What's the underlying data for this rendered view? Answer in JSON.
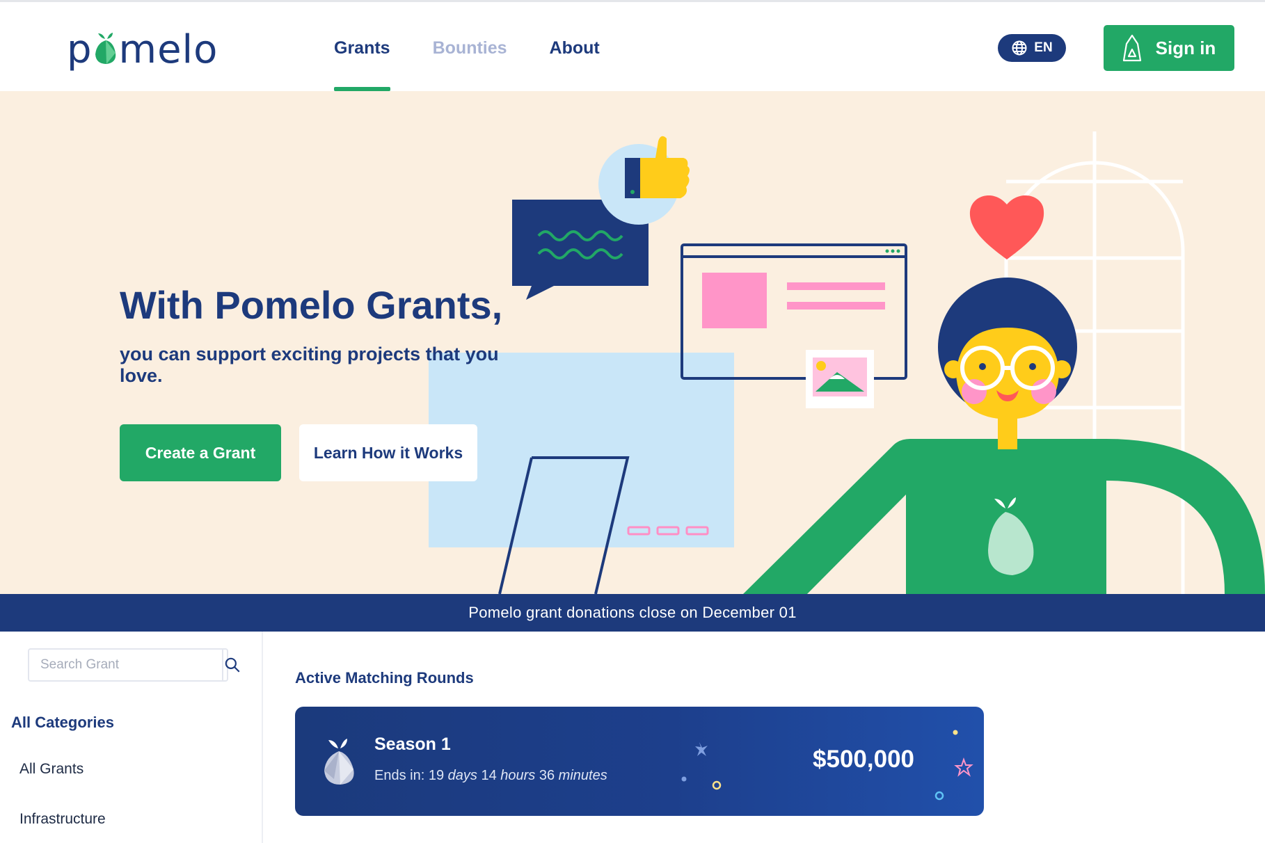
{
  "brand": {
    "name": "pomelo",
    "accent": "#22a866",
    "navy": "#1d3a7c",
    "hero_bg": "#fbefe0"
  },
  "nav": {
    "items": [
      {
        "label": "Grants",
        "state": "active"
      },
      {
        "label": "Bounties",
        "state": "muted"
      },
      {
        "label": "About",
        "state": "normal"
      }
    ]
  },
  "header": {
    "language": "EN",
    "language_icon": "globe-icon",
    "signin_label": "Sign in",
    "signin_icon": "argent-logo-icon"
  },
  "hero": {
    "title": "With Pomelo Grants,",
    "subtitle": "you can support exciting projects that you love.",
    "primary_button": "Create a Grant",
    "secondary_button": "Learn How it Works"
  },
  "banner": {
    "text": "Pomelo grant donations close on December 01"
  },
  "sidebar": {
    "search_placeholder": "Search Grant",
    "search_icon": "search-icon",
    "categories_title": "All Categories",
    "categories": [
      "All Grants",
      "Infrastructure"
    ]
  },
  "main": {
    "section_title": "Active Matching Rounds",
    "round": {
      "name": "Season 1",
      "ends_prefix": "Ends in:",
      "days_value": "19",
      "days_unit": "days",
      "hours_value": "14",
      "hours_unit": "hours",
      "minutes_value": "36",
      "minutes_unit": "minutes",
      "amount": "$500,000"
    }
  }
}
